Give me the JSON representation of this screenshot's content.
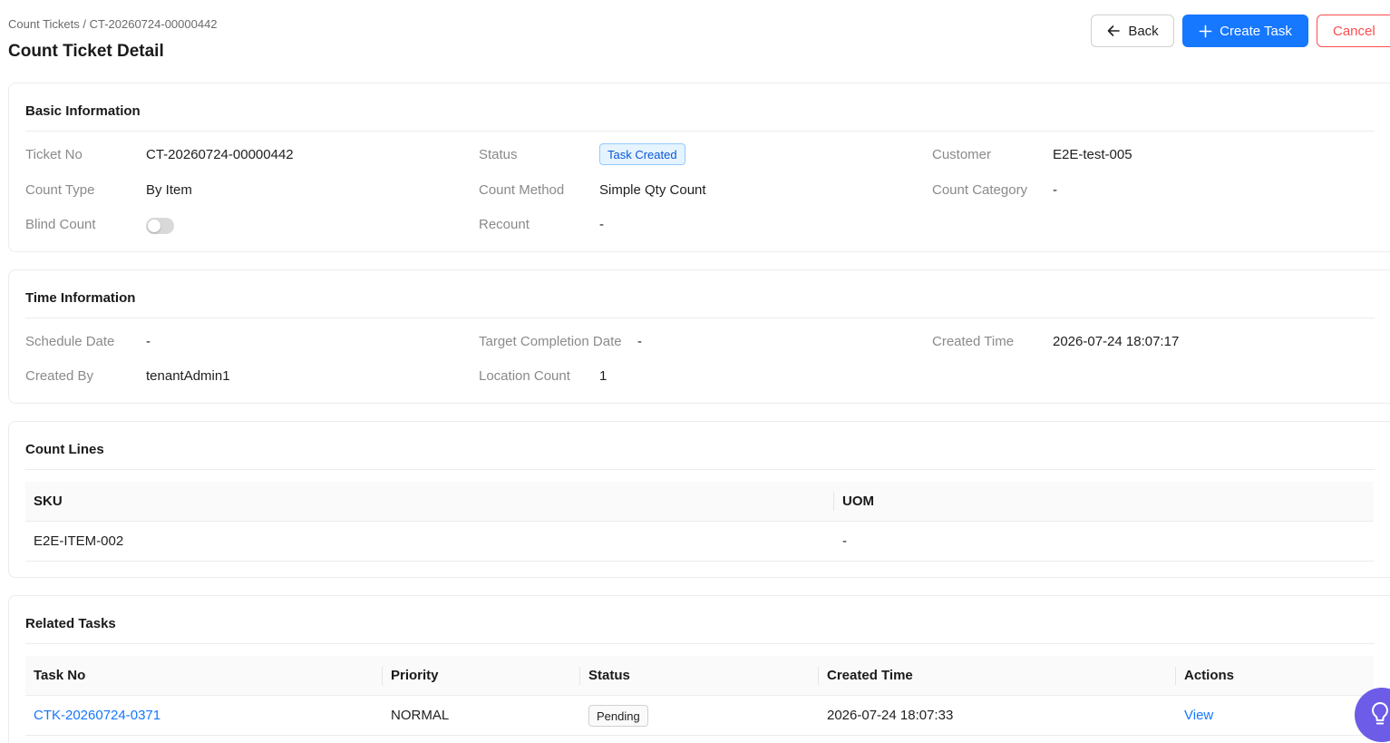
{
  "breadcrumb": "Count Tickets / CT-20260724-00000442",
  "page_title": "Count Ticket Detail",
  "actions": {
    "back_label": "Back",
    "create_task_label": "Create Task",
    "cancel_label": "Cancel"
  },
  "basic_info": {
    "title": "Basic Information",
    "ticket_no_label": "Ticket No",
    "ticket_no": "CT-20260724-00000442",
    "status_label": "Status",
    "status": "Task Created",
    "customer_label": "Customer",
    "customer": "E2E-test-005",
    "count_type_label": "Count Type",
    "count_type": "By Item",
    "count_method_label": "Count Method",
    "count_method": "Simple Qty Count",
    "count_category_label": "Count Category",
    "count_category": "-",
    "blind_count_label": "Blind Count",
    "blind_count_enabled": false,
    "recount_label": "Recount",
    "recount": "-"
  },
  "time_info": {
    "title": "Time Information",
    "schedule_date_label": "Schedule Date",
    "schedule_date": "-",
    "target_completion_label": "Target Completion Date",
    "target_completion": "-",
    "created_time_label": "Created Time",
    "created_time": "2026-07-24 18:07:17",
    "created_by_label": "Created By",
    "created_by": "tenantAdmin1",
    "location_count_label": "Location Count",
    "location_count": "1"
  },
  "count_lines": {
    "title": "Count Lines",
    "columns": [
      "SKU",
      "UOM"
    ],
    "rows": [
      {
        "sku": "E2E-ITEM-002",
        "uom": "-"
      }
    ]
  },
  "related_tasks": {
    "title": "Related Tasks",
    "columns": [
      "Task No",
      "Priority",
      "Status",
      "Created Time",
      "Actions"
    ],
    "rows": [
      {
        "task_no": "CTK-20260724-0371",
        "priority": "NORMAL",
        "status": "Pending",
        "created_time": "2026-07-24 18:07:33",
        "action": "View"
      }
    ]
  },
  "colors": {
    "primary": "#1677ff",
    "danger": "#ff4d4f",
    "tag_blue_bg": "#e6f4ff",
    "help_fab": "#6c5ce7"
  },
  "icons": {
    "back": "arrow-left-icon",
    "create": "plus-icon",
    "help": "lightbulb-icon"
  }
}
